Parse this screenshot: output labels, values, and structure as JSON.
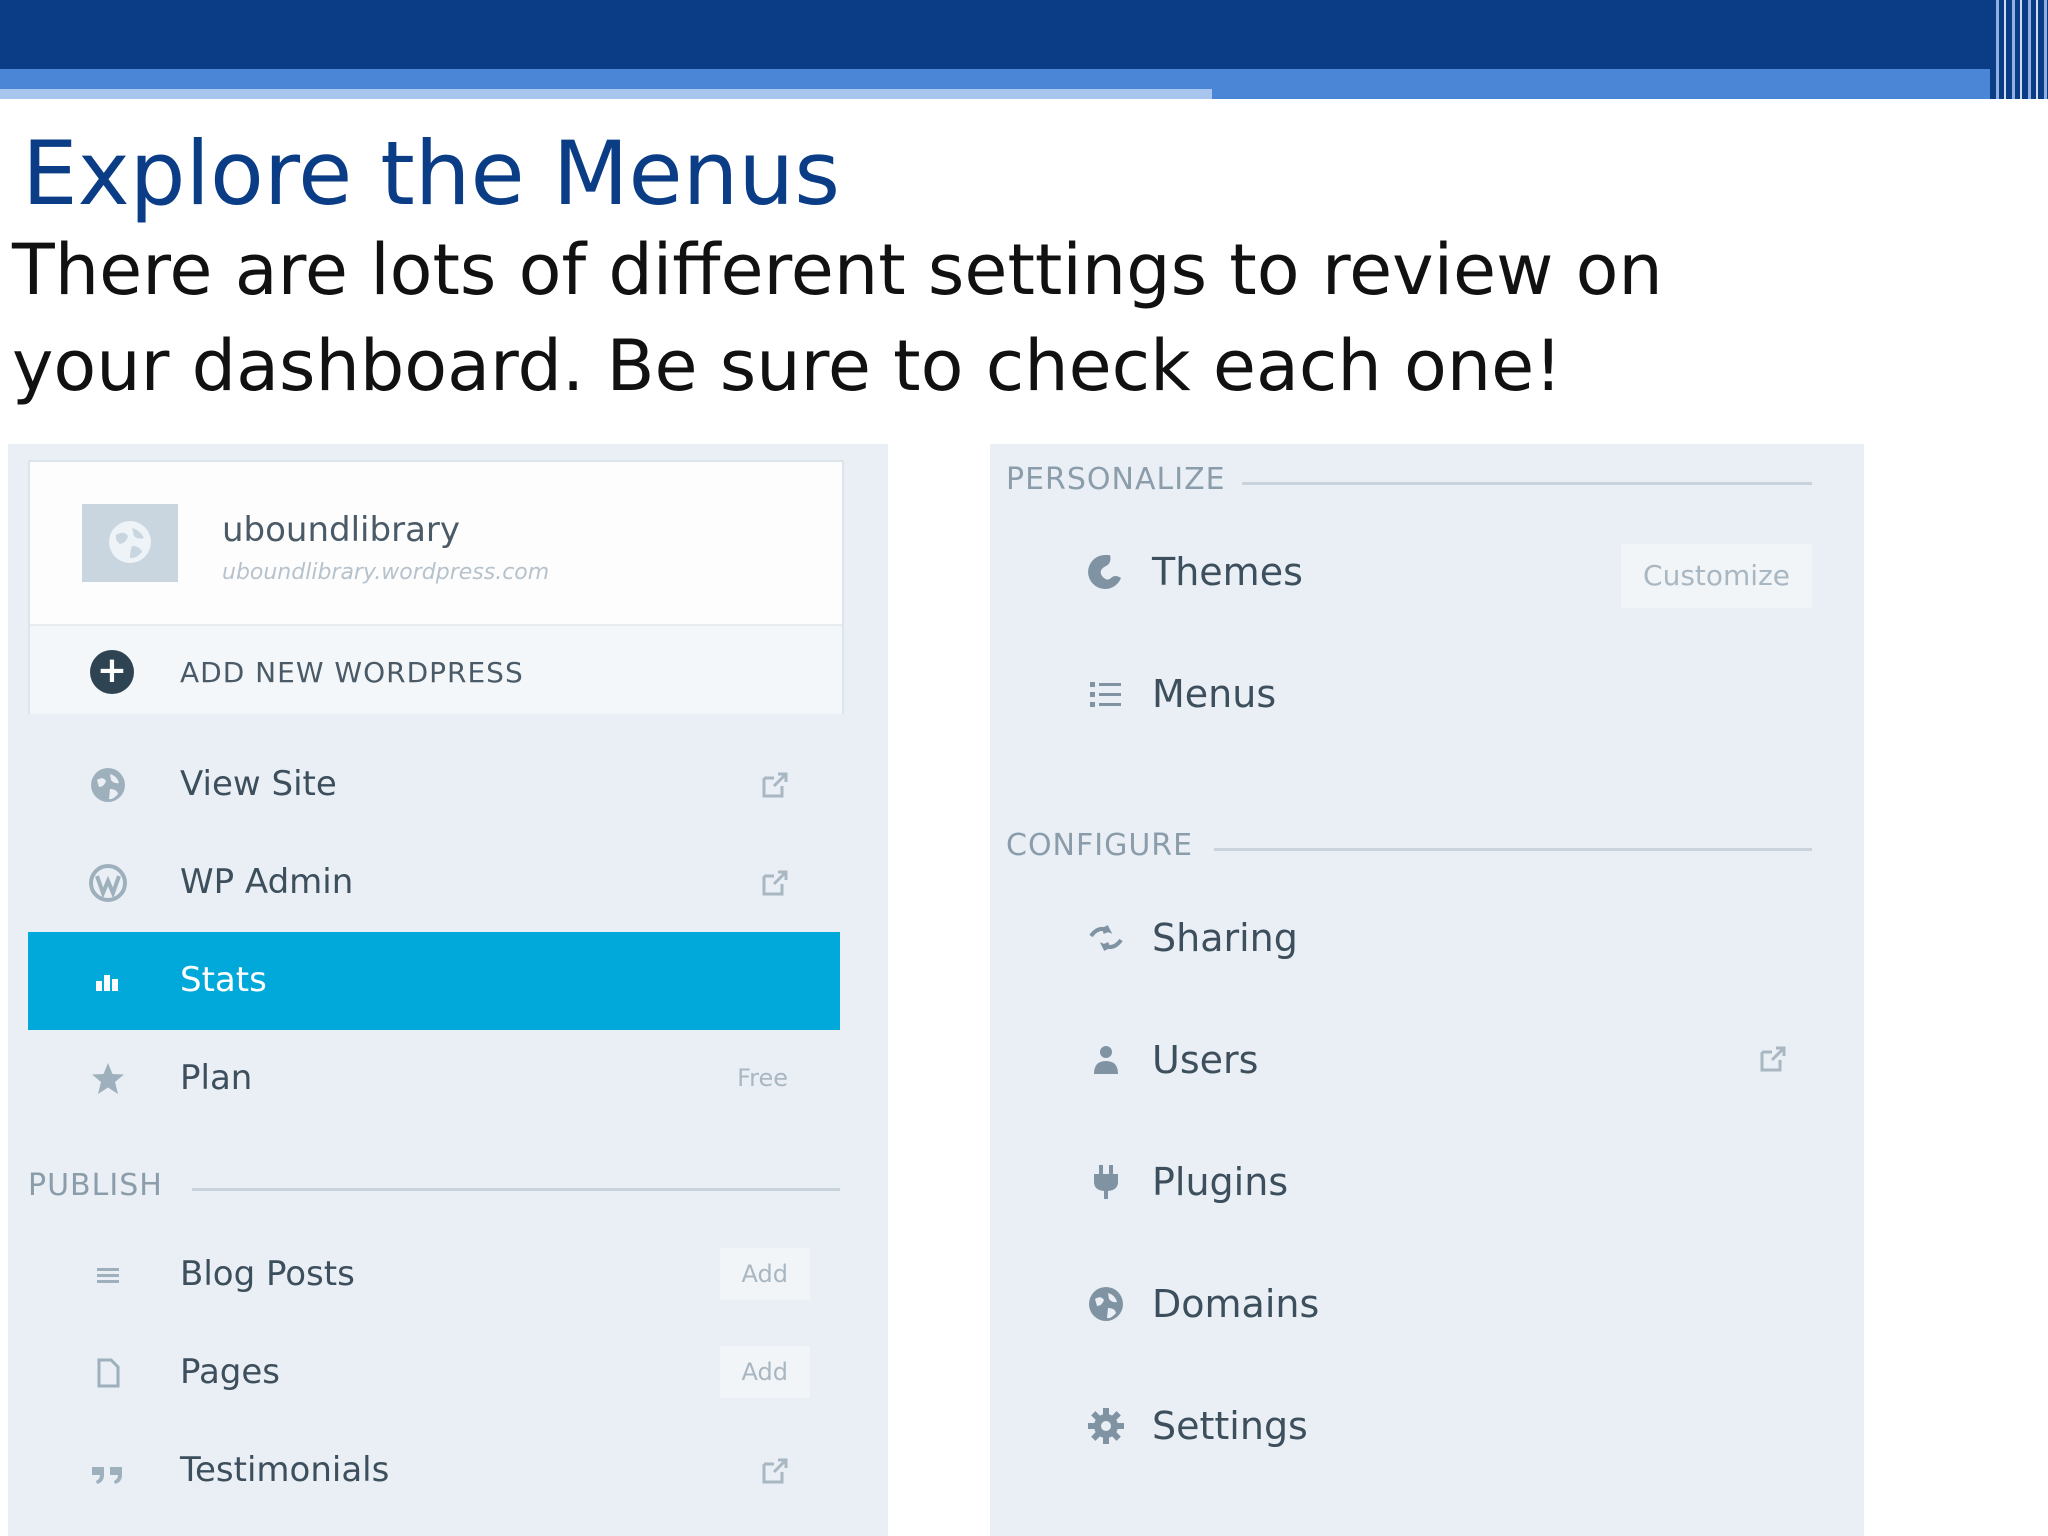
{
  "slide": {
    "title": "Explore the Menus",
    "body": "There are lots of different settings to review on your dashboard. Be sure to check each one!"
  },
  "colors": {
    "header_band": "#0b3d86",
    "accent_band": "#4a85d6",
    "active_item": "#00a9d9",
    "panel_bg": "#e9eff5"
  },
  "left_panel": {
    "site": {
      "name": "uboundlibrary",
      "url": "uboundlibrary.wordpress.com",
      "icon": "globe-icon"
    },
    "add_new": {
      "label": "ADD NEW WORDPRESS",
      "icon": "plus-circle-icon"
    },
    "items": [
      {
        "label": "View Site",
        "icon": "globe-icon",
        "trailing": "external-link-icon"
      },
      {
        "label": "WP Admin",
        "icon": "wordpress-icon",
        "trailing": "external-link-icon"
      },
      {
        "label": "Stats",
        "icon": "bar-chart-icon",
        "active": true
      },
      {
        "label": "Plan",
        "icon": "star-icon",
        "tag": "Free"
      }
    ],
    "publish": {
      "heading": "PUBLISH",
      "items": [
        {
          "label": "Blog Posts",
          "icon": "lines-icon",
          "tag": "Add"
        },
        {
          "label": "Pages",
          "icon": "page-icon",
          "tag": "Add"
        },
        {
          "label": "Testimonials",
          "icon": "quote-icon",
          "trailing": "external-link-icon"
        }
      ]
    }
  },
  "right_panel": {
    "personalize": {
      "heading": "PERSONALIZE",
      "items": [
        {
          "label": "Themes",
          "icon": "palette-icon",
          "tag": "Customize"
        },
        {
          "label": "Menus",
          "icon": "list-icon"
        }
      ]
    },
    "configure": {
      "heading": "CONFIGURE",
      "items": [
        {
          "label": "Sharing",
          "icon": "share-icon"
        },
        {
          "label": "Users",
          "icon": "user-icon",
          "trailing": "external-link-icon"
        },
        {
          "label": "Plugins",
          "icon": "plug-icon"
        },
        {
          "label": "Domains",
          "icon": "globe-icon"
        },
        {
          "label": "Settings",
          "icon": "gear-icon"
        }
      ]
    }
  }
}
